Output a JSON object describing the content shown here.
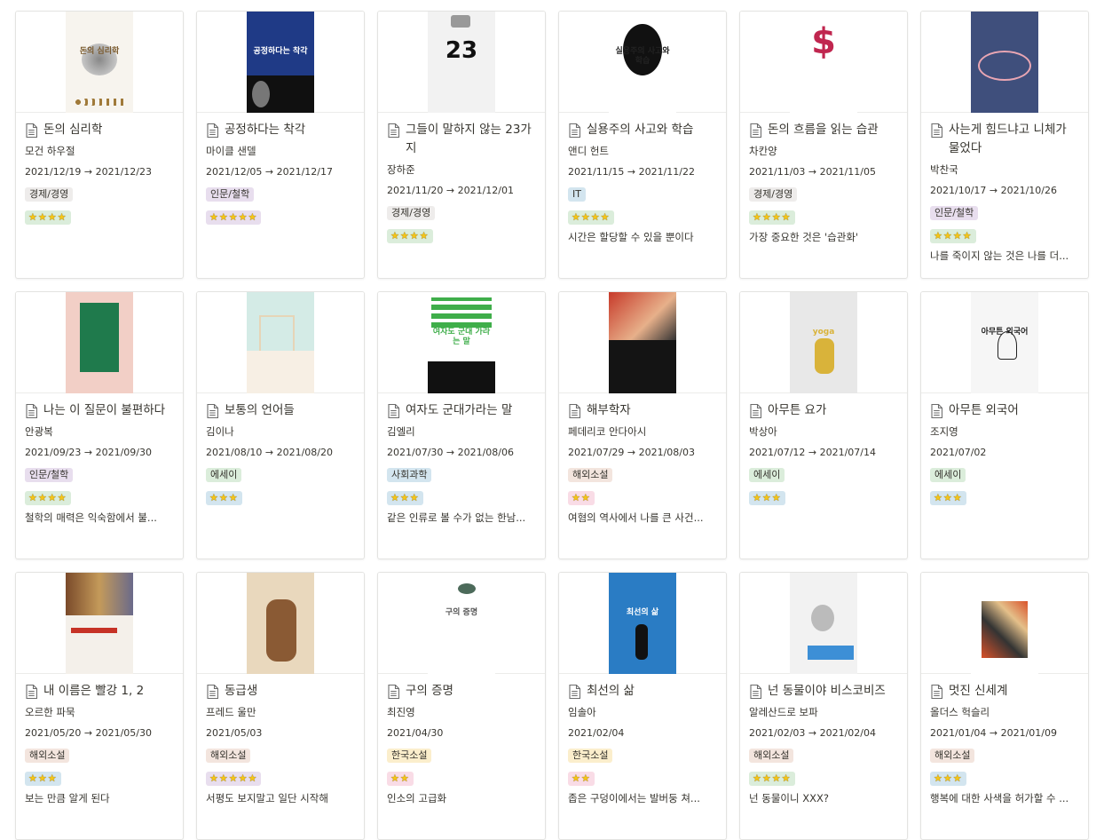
{
  "cards": [
    {
      "title": "돈의 심리학",
      "author": "모건 하우절",
      "date": "2021/12/19 → 2021/12/23",
      "category": "경제/경영",
      "rating": 4,
      "quote": "",
      "cover_bg": "#f7f4ee",
      "cover_fg": "#7a5a2e",
      "cover_text": "돈의 심리학"
    },
    {
      "title": "공정하다는 착각",
      "author": "마이클 샌델",
      "date": "2021/12/05 → 2021/12/17",
      "category": "인문/철학",
      "rating": 5,
      "quote": "",
      "cover_bg": "#1f3a86",
      "cover_fg": "#ffffff",
      "cover_text": "공정하다는 착각"
    },
    {
      "title": "그들이 말하지 않는 23가지",
      "author": "장하준",
      "date": "2021/11/20 → 2021/12/01",
      "category": "경제/경영",
      "rating": 4,
      "quote": "",
      "cover_bg": "#f2f2f2",
      "cover_fg": "#111111",
      "cover_text": "23"
    },
    {
      "title": "실용주의 사고와 학습",
      "author": "앤디 헌트",
      "date": "2021/11/15 → 2021/11/22",
      "category": "IT",
      "rating": 4,
      "quote": "시간은 할당할 수 있을 뿐이다",
      "cover_bg": "#ffffff",
      "cover_fg": "#222222",
      "cover_text": "실용주의 사고와 학습"
    },
    {
      "title": "돈의 흐름을 읽는 습관",
      "author": "차칸양",
      "date": "2021/11/03 → 2021/11/05",
      "category": "경제/경영",
      "rating": 4,
      "quote": "가장 중요한 것은 '습관화'",
      "cover_bg": "#ffffff",
      "cover_fg": "#c0264f",
      "cover_text": "$"
    },
    {
      "title": "사는게 힘드냐고 니체가 물었다",
      "author": "박찬국",
      "date": "2021/10/17 → 2021/10/26",
      "category": "인문/철학",
      "rating": 4,
      "quote": "나를 죽이지 않는 것은 나를 더...",
      "cover_bg": "#3f4f7c",
      "cover_fg": "#e9a6b3",
      "cover_text": ""
    },
    {
      "title": "나는 이 질문이 불편하다",
      "author": "안광복",
      "date": "2021/09/23 → 2021/09/30",
      "category": "인문/철학",
      "rating": 4,
      "quote": "철학의 매력은 익숙함에서 불...",
      "cover_bg": "#f2cfc6",
      "cover_fg": "#2e8a5a",
      "cover_text": ""
    },
    {
      "title": "보통의 언어들",
      "author": "김이나",
      "date": "2021/08/10 → 2021/08/20",
      "category": "에세이",
      "rating": 3,
      "quote": "",
      "cover_bg": "#d4ebe6",
      "cover_fg": "#e6d5b7",
      "cover_text": ""
    },
    {
      "title": "여자도 군대가라는 말",
      "author": "김엘리",
      "date": "2021/07/30 → 2021/08/06",
      "category": "사회과학",
      "rating": 3,
      "quote": "같은 인류로 볼 수가 없는 한남...",
      "cover_bg": "#ffffff",
      "cover_fg": "#3fae4a",
      "cover_text": "여자도 군대 가라는 말"
    },
    {
      "title": "해부학자",
      "author": "페데리코 안다아시",
      "date": "2021/07/29 → 2021/08/03",
      "category": "해외소설",
      "rating": 2,
      "quote": "여혐의 역사에서 나를 큰 사건...",
      "cover_bg": "#141414",
      "cover_fg": "#c73a2a",
      "cover_text": ""
    },
    {
      "title": "아무튼 요가",
      "author": "박상아",
      "date": "2021/07/12 → 2021/07/14",
      "category": "에세이",
      "rating": 3,
      "quote": "",
      "cover_bg": "#e8e8e8",
      "cover_fg": "#d9b33a",
      "cover_text": "yoga"
    },
    {
      "title": "아무튼 외국어",
      "author": "조지영",
      "date": "2021/07/02",
      "category": "에세이",
      "rating": 3,
      "quote": "",
      "cover_bg": "#f6f6f6",
      "cover_fg": "#222222",
      "cover_text": "아무튼 외국어"
    },
    {
      "title": "내 이름은 빨강 1, 2",
      "author": "오르한 파묵",
      "date": "2021/05/20 → 2021/05/30",
      "category": "해외소설",
      "rating": 3,
      "quote": "보는 만큼 알게 된다",
      "cover_bg": "#f4f0ea",
      "cover_fg": "#c63226",
      "cover_text": ""
    },
    {
      "title": "동급생",
      "author": "프레드 울만",
      "date": "2021/05/03",
      "category": "해외소설",
      "rating": 5,
      "quote": "서평도 보지말고 일단 시작해",
      "cover_bg": "#e9d8bd",
      "cover_fg": "#6a4a2c",
      "cover_text": ""
    },
    {
      "title": "구의 증명",
      "author": "최진영",
      "date": "2021/04/30",
      "category": "한국소설",
      "rating": 2,
      "quote": "인소의 고급화",
      "cover_bg": "#ffffff",
      "cover_fg": "#555555",
      "cover_text": "구의 증명"
    },
    {
      "title": "최선의 삶",
      "author": "임솔아",
      "date": "2021/02/04",
      "category": "한국소설",
      "rating": 2,
      "quote": "좁은 구덩이에서는 발버둥 쳐...",
      "cover_bg": "#2a7cc4",
      "cover_fg": "#ffffff",
      "cover_text": "최선의 삶"
    },
    {
      "title": "넌 동물이야 비스코비즈",
      "author": "알레산드로 보파",
      "date": "2021/02/03 → 2021/02/04",
      "category": "해외소설",
      "rating": 4,
      "quote": "넌 동물이니 XXX?",
      "cover_bg": "#f2f2f2",
      "cover_fg": "#3d8fd6",
      "cover_text": ""
    },
    {
      "title": "멋진 신세계",
      "author": "올더스 헉슬리",
      "date": "2021/01/04 → 2021/01/09",
      "category": "해외소설",
      "rating": 3,
      "quote": "행복에 대한 사색을 허가할 수 ...",
      "cover_bg": "#ffffff",
      "cover_fg": "#d9522a",
      "cover_text": ""
    }
  ],
  "colors": {
    "경제/경영": "#eeeceb",
    "인문/철학": "#e8deee",
    "IT": "#d3e5ef",
    "에세이": "#dbeddb",
    "사회과학": "#d3e5ef",
    "해외소설": "#f3e5de",
    "한국소설": "#fbeecc",
    "star_bg": {
      "2": "#f9dce6",
      "3": "#d3e5ef",
      "4": "#dbeddb",
      "5": "#e8deee"
    }
  },
  "icons": {
    "page": "doc-icon",
    "star": "star-icon"
  }
}
